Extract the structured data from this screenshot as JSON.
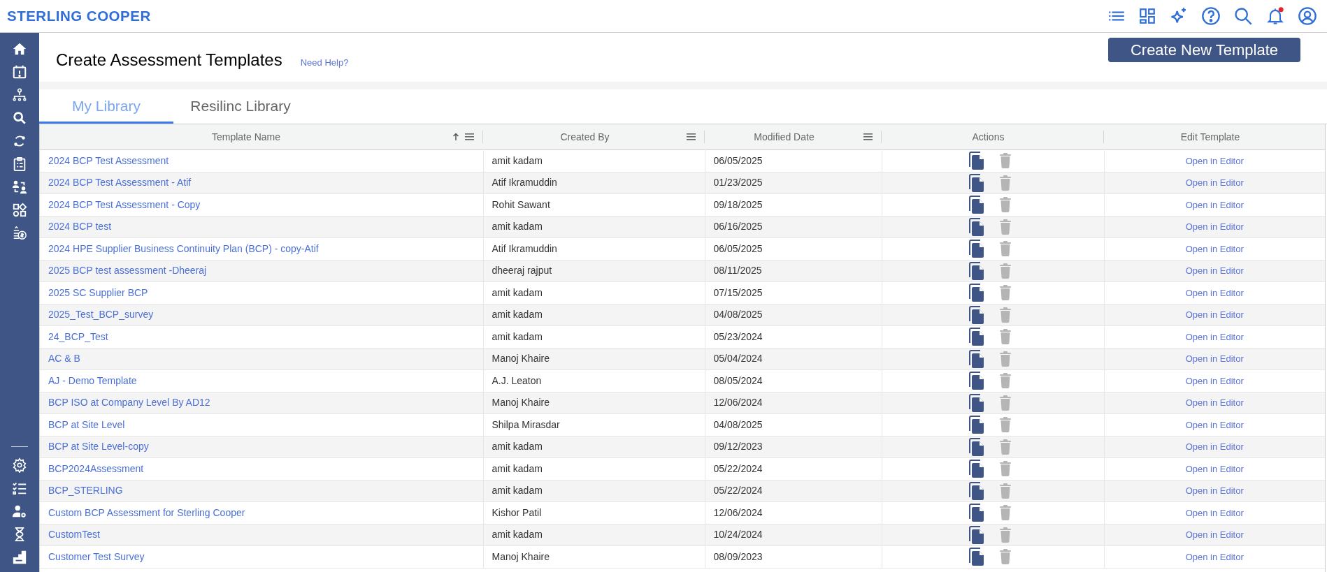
{
  "brand": "STERLING COOPER",
  "page_title": "Create Assessment Templates",
  "help_link": "Need Help?",
  "create_button": "Create New Template",
  "notification_unread": true,
  "tabs": [
    {
      "label": "My Library",
      "selected": true
    },
    {
      "label": "Resilinc Library",
      "selected": false
    }
  ],
  "table": {
    "columns": [
      {
        "label": "Template Name",
        "sorted": true,
        "menu": true
      },
      {
        "label": "Created By",
        "sorted": false,
        "menu": true
      },
      {
        "label": "Modified Date",
        "sorted": false,
        "menu": true
      },
      {
        "label": "Actions",
        "sorted": false,
        "menu": false
      },
      {
        "label": "Edit Template",
        "sorted": false,
        "menu": false
      }
    ],
    "rows": [
      {
        "name": "2024 BCP Test Assessment",
        "created_by": "amit kadam",
        "modified": "06/05/2025",
        "edit": "Open in Editor"
      },
      {
        "name": "2024 BCP Test Assessment - Atif",
        "created_by": "Atif Ikramuddin",
        "modified": "01/23/2025",
        "edit": "Open in Editor"
      },
      {
        "name": "2024 BCP Test Assessment - Copy",
        "created_by": "Rohit Sawant",
        "modified": "09/18/2025",
        "edit": "Open in Editor"
      },
      {
        "name": "2024 BCP test",
        "created_by": "amit kadam",
        "modified": "06/16/2025",
        "edit": "Open in Editor"
      },
      {
        "name": "2024 HPE Supplier Business Continuity Plan (BCP) - copy-Atif",
        "created_by": "Atif Ikramuddin",
        "modified": "06/05/2025",
        "edit": "Open in Editor"
      },
      {
        "name": "2025 BCP test assessment -Dheeraj",
        "created_by": "dheeraj rajput",
        "modified": "08/11/2025",
        "edit": "Open in Editor"
      },
      {
        "name": "2025 SC Supplier BCP",
        "created_by": "amit kadam",
        "modified": "07/15/2025",
        "edit": "Open in Editor"
      },
      {
        "name": "2025_Test_BCP_survey",
        "created_by": "amit kadam",
        "modified": "04/08/2025",
        "edit": "Open in Editor"
      },
      {
        "name": "24_BCP_Test",
        "created_by": "amit kadam",
        "modified": "05/23/2024",
        "edit": "Open in Editor"
      },
      {
        "name": "AC & B",
        "created_by": "Manoj Khaire",
        "modified": "05/04/2024",
        "edit": "Open in Editor"
      },
      {
        "name": "AJ - Demo Template",
        "created_by": "A.J. Leaton",
        "modified": "08/05/2024",
        "edit": "Open in Editor"
      },
      {
        "name": "BCP ISO at Company Level By AD12",
        "created_by": "Manoj Khaire",
        "modified": "12/06/2024",
        "edit": "Open in Editor"
      },
      {
        "name": "BCP at Site Level",
        "created_by": "Shilpa Mirasdar",
        "modified": "04/08/2025",
        "edit": "Open in Editor"
      },
      {
        "name": "BCP at Site Level-copy",
        "created_by": "amit kadam",
        "modified": "09/12/2023",
        "edit": "Open in Editor"
      },
      {
        "name": "BCP2024Assessment",
        "created_by": "amit kadam",
        "modified": "05/22/2024",
        "edit": "Open in Editor"
      },
      {
        "name": "BCP_STERLING",
        "created_by": "amit kadam",
        "modified": "05/22/2024",
        "edit": "Open in Editor"
      },
      {
        "name": "Custom BCP Assessment for Sterling Cooper",
        "created_by": "Kishor Patil",
        "modified": "12/06/2024",
        "edit": "Open in Editor"
      },
      {
        "name": "CustomTest",
        "created_by": "amit kadam",
        "modified": "10/24/2024",
        "edit": "Open in Editor"
      },
      {
        "name": "Customer Test Survey",
        "created_by": "Manoj Khaire",
        "modified": "08/09/2023",
        "edit": "Open in Editor"
      }
    ]
  }
}
